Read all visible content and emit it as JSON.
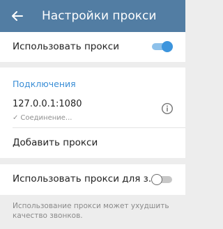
{
  "appbar": {
    "back_icon": "arrow-left-icon",
    "title": "Настройки прокси"
  },
  "use_proxy": {
    "label": "Использовать прокси",
    "enabled": true
  },
  "connections": {
    "header": "Подключения",
    "proxy": {
      "address": "127.0.0.1:1080",
      "status": "Соединение...",
      "status_icon": "checkmark-icon",
      "info_icon": "info-icon"
    },
    "add_label": "Добавить прокси"
  },
  "calls_proxy": {
    "label": "Использовать прокси для з...",
    "enabled": false
  },
  "footer_note": "Использование прокси может ухудшить качество звонков.",
  "colors": {
    "appbar": "#527da3",
    "accent": "#3d95dd",
    "header_text": "#3a8ed6"
  }
}
